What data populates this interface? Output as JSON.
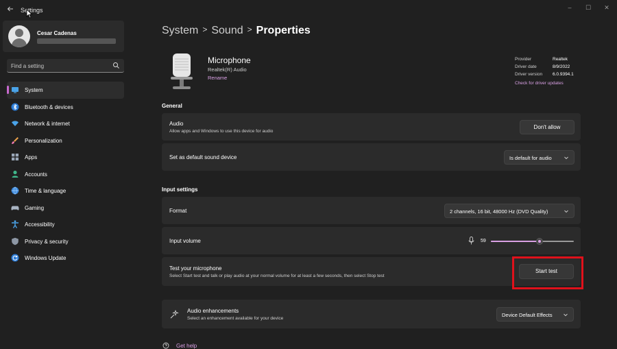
{
  "window": {
    "title": "Settings",
    "controls": {
      "minimize": "–",
      "maximize": "☐",
      "close": "✕"
    }
  },
  "profile": {
    "name": "Cesar Cadenas"
  },
  "search": {
    "placeholder": "Find a setting"
  },
  "sidebar": {
    "items": [
      {
        "label": "System",
        "icon": "system-icon",
        "active": true
      },
      {
        "label": "Bluetooth & devices",
        "icon": "bluetooth-icon"
      },
      {
        "label": "Network & internet",
        "icon": "wifi-icon"
      },
      {
        "label": "Personalization",
        "icon": "brush-icon"
      },
      {
        "label": "Apps",
        "icon": "apps-icon"
      },
      {
        "label": "Accounts",
        "icon": "accounts-icon"
      },
      {
        "label": "Time & language",
        "icon": "globe-icon"
      },
      {
        "label": "Gaming",
        "icon": "gamepad-icon"
      },
      {
        "label": "Accessibility",
        "icon": "accessibility-icon"
      },
      {
        "label": "Privacy & security",
        "icon": "shield-icon"
      },
      {
        "label": "Windows Update",
        "icon": "update-icon"
      }
    ]
  },
  "breadcrumb": {
    "part1": "System",
    "part2": "Sound",
    "current": "Properties"
  },
  "device": {
    "name": "Microphone",
    "subtitle": "Realtek(R) Audio",
    "rename": "Rename",
    "provider_label": "Provider",
    "provider": "Realtek",
    "date_label": "Driver date",
    "date": "8/9/2022",
    "version_label": "Driver version",
    "version": "6.0.9394.1",
    "update_link": "Check for driver updates"
  },
  "general": {
    "title": "General",
    "audio_title": "Audio",
    "audio_desc": "Allow apps and Windows to use this device for audio",
    "audio_button": "Don't allow",
    "default_title": "Set as default sound device",
    "default_value": "Is default for audio"
  },
  "input": {
    "title": "Input settings",
    "format_title": "Format",
    "format_value": "2 channels, 16 bit, 48000 Hz (DVD Quality)",
    "volume_title": "Input volume",
    "volume_value": "59",
    "test_title": "Test your microphone",
    "test_desc": "Select Start test and talk or play audio at your normal volume for at least a few seconds, then select Stop test",
    "test_button": "Start test"
  },
  "enhancements": {
    "title": "Audio enhancements",
    "desc": "Select an enhancement available for your device",
    "value": "Device Default Effects"
  },
  "help": {
    "label": "Get help"
  },
  "colors": {
    "accent": "#d9a0e4",
    "highlight": "#e0111b",
    "background": "#202020",
    "card": "#2b2b2b"
  }
}
